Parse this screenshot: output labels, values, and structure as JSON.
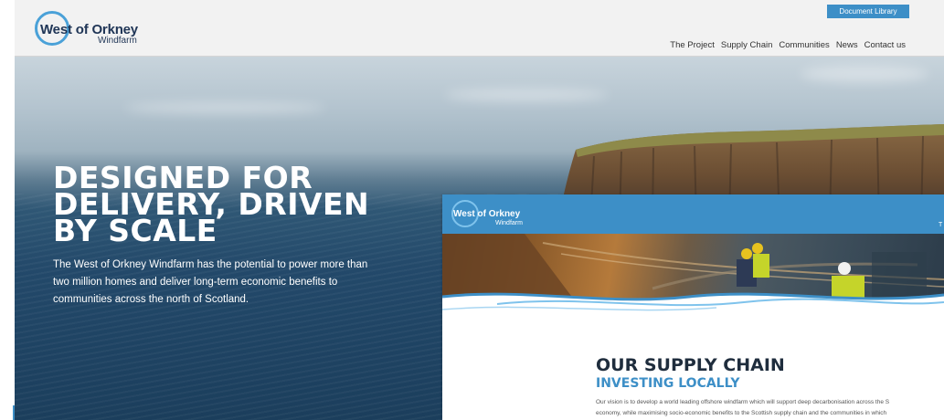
{
  "header": {
    "logo": {
      "title": "West of Orkney",
      "subtitle": "Windfarm"
    },
    "document_library": "Document Library",
    "nav": [
      "The Project",
      "Supply Chain",
      "Communities",
      "News",
      "Contact us"
    ]
  },
  "hero": {
    "title_lines": [
      "DESIGNED FOR",
      "DELIVERY, DRIVEN",
      "BY SCALE"
    ],
    "text": "The West of Orkney Windfarm has the potential to power more than two million homes and deliver long-term economic benefits to communities across the north of Scotland."
  },
  "overlay": {
    "logo": {
      "title": "West of Orkney",
      "subtitle": "Windfarm"
    },
    "nav_partial": "T",
    "title": "OUR SUPPLY CHAIN",
    "subtitle": "INVESTING LOCALLY",
    "text_lines": [
      "Our vision is to develop a world leading offshore windfarm which will support deep decarbonisation across the S",
      "economy, while maximising socio-economic benefits to the Scottish supply chain and the communities in which"
    ]
  },
  "colors": {
    "brand_blue": "#3d8fc7",
    "navy": "#1f3556",
    "header_bg": "#f2f2f2"
  }
}
